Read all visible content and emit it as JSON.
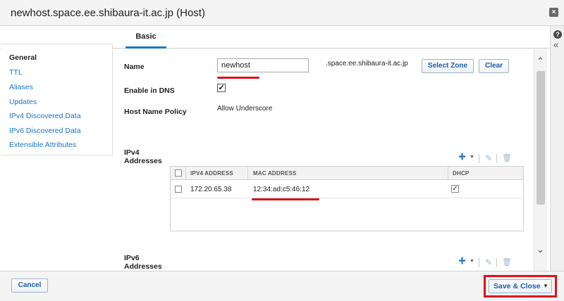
{
  "dialog": {
    "title": "newhost.space.ee.shibaura-it.ac.jp (Host)",
    "close_icon": "close-icon"
  },
  "tabs": [
    {
      "label": "Basic",
      "active": true
    }
  ],
  "sidebar": {
    "items": [
      {
        "label": "General",
        "active": true
      },
      {
        "label": "TTL"
      },
      {
        "label": "Aliases"
      },
      {
        "label": "Updates"
      },
      {
        "label": "IPv4 Discovered Data"
      },
      {
        "label": "IPv6 Discovered Data"
      },
      {
        "label": "Extensible Attributes"
      }
    ]
  },
  "form": {
    "name_label": "Name",
    "name_value": "newhost",
    "domain_suffix": ".space.ee.shibaura-it.ac.jp",
    "select_zone_label": "Select Zone",
    "clear_label": "Clear",
    "enable_dns_label": "Enable in DNS",
    "enable_dns_checked": true,
    "host_name_policy_label": "Host Name Policy",
    "host_name_policy_value": "Allow Underscore",
    "ipv4_label_line1": "IPv4",
    "ipv4_label_line2": "Addresses",
    "ipv6_label_line1": "IPv6",
    "ipv6_label_line2": "Addresses"
  },
  "ipv4_table": {
    "columns": [
      "IPV4 ADDRESS",
      "MAC ADDRESS",
      "DHCP"
    ],
    "rows": [
      {
        "ipv4": "172.20.65.38",
        "mac": "12:34:ad:c5:46:12",
        "dhcp": true
      }
    ]
  },
  "footer": {
    "cancel_label": "Cancel",
    "save_label": "Save & Close"
  },
  "colors": {
    "accent": "#1a73c8",
    "highlight": "#e0121c"
  }
}
